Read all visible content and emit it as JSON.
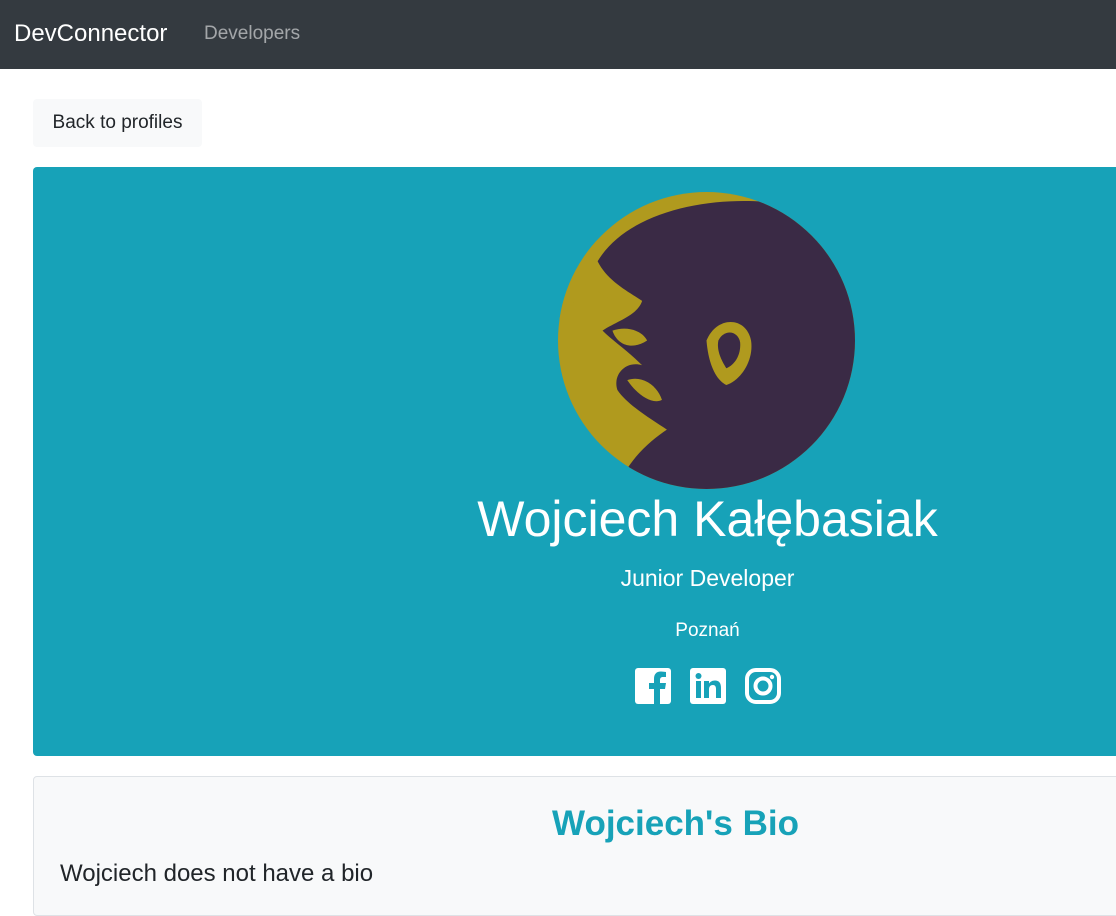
{
  "navbar": {
    "brand": "DevConnector",
    "links": [
      {
        "label": "Developers"
      }
    ]
  },
  "actions": {
    "back_label": "Back to profiles"
  },
  "profile": {
    "name": "Wojciech Kałębasiak",
    "title": "Junior Developer",
    "location": "Poznań",
    "avatar_icon": "user-avatar",
    "social_icons": [
      "facebook-icon",
      "linkedin-icon",
      "instagram-icon"
    ]
  },
  "bio": {
    "heading": "Wojciech's Bio",
    "text": "Wojciech does not have a bio"
  },
  "colors": {
    "navbar_bg": "#343a40",
    "accent": "#17a2b8",
    "card_bg": "#f8f9fa",
    "avatar_bg": "#b09a1e",
    "avatar_fg": "#3a2a45"
  }
}
